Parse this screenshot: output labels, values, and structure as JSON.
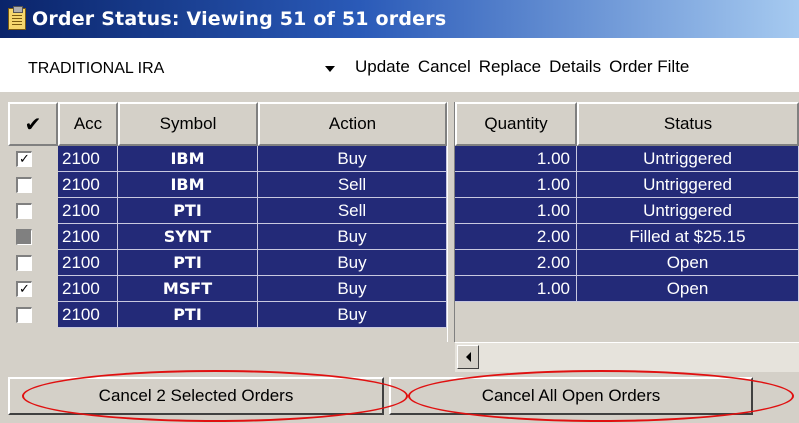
{
  "window": {
    "title": "Order Status: Viewing 51 of 51 orders"
  },
  "toolbar": {
    "account": "TRADITIONAL IRA",
    "menu": [
      "Update",
      "Cancel",
      "Replace",
      "Details",
      "Order Filte"
    ]
  },
  "table": {
    "headers": {
      "check": "✔",
      "acc": "Acc",
      "symbol": "Symbol",
      "action": "Action",
      "quantity": "Quantity",
      "status": "Status"
    },
    "rows": [
      {
        "checked": "checked",
        "acc": "2100",
        "symbol": "IBM",
        "action": "Buy",
        "quantity": "1.00",
        "status": "Untriggered"
      },
      {
        "checked": "unchecked",
        "acc": "2100",
        "symbol": "IBM",
        "action": "Sell",
        "quantity": "1.00",
        "status": "Untriggered"
      },
      {
        "checked": "unchecked",
        "acc": "2100",
        "symbol": "PTI",
        "action": "Sell",
        "quantity": "1.00",
        "status": "Untriggered"
      },
      {
        "checked": "disabled",
        "acc": "2100",
        "symbol": "SYNT",
        "action": "Buy",
        "quantity": "2.00",
        "status": "Filled at $25.15"
      },
      {
        "checked": "unchecked",
        "acc": "2100",
        "symbol": "PTI",
        "action": "Buy",
        "quantity": "2.00",
        "status": "Open"
      },
      {
        "checked": "checked",
        "acc": "2100",
        "symbol": "MSFT",
        "action": "Buy",
        "quantity": "1.00",
        "status": "Open"
      },
      {
        "checked": "unchecked",
        "acc": "2100",
        "symbol": "PTI",
        "action": "Buy",
        "quantity": "",
        "status": ""
      }
    ]
  },
  "buttons": {
    "cancel_selected": "Cancel 2 Selected Orders",
    "cancel_all": "Cancel All Open Orders"
  },
  "colors": {
    "row_bg": "#232a78",
    "annotation": "#e01010"
  }
}
